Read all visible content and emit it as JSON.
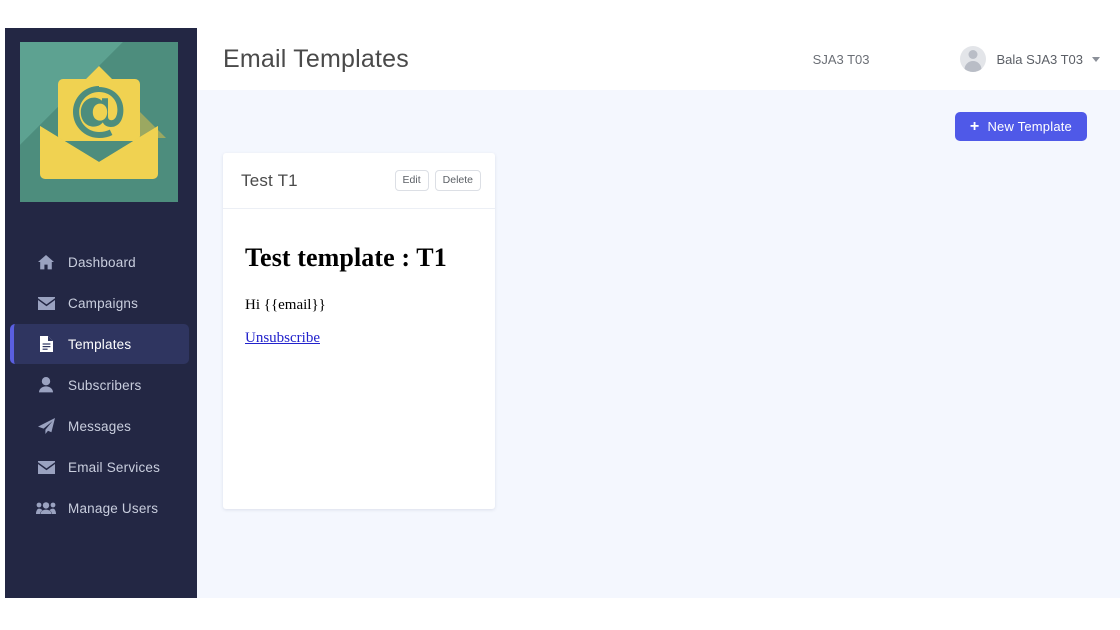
{
  "sidebar": {
    "logo": {
      "name": "email-app-logo",
      "symbol": "@",
      "tile_color": "#5da291",
      "shadow_color": "#4d8d7d",
      "envelope_color": "#f0d251"
    },
    "items": [
      {
        "label": "Dashboard",
        "icon": "home-icon",
        "active": false
      },
      {
        "label": "Campaigns",
        "icon": "envelope-icon",
        "active": false
      },
      {
        "label": "Templates",
        "icon": "document-icon",
        "active": true
      },
      {
        "label": "Subscribers",
        "icon": "user-icon",
        "active": false
      },
      {
        "label": "Messages",
        "icon": "paper-plane-icon",
        "active": false
      },
      {
        "label": "Email Services",
        "icon": "envelope-icon",
        "active": false
      },
      {
        "label": "Manage Users",
        "icon": "users-icon",
        "active": false
      }
    ]
  },
  "header": {
    "title": "Email Templates",
    "tenant": "SJA3 T03",
    "user_name": "Bala SJA3 T03",
    "avatar": "user-avatar-placeholder",
    "caret": "chevron-down-icon"
  },
  "toolbar": {
    "new_template_label": "New Template",
    "new_template_icon": "plus-icon",
    "button_color": "#4f59e8",
    "annotation_color": "#dd3b3b"
  },
  "templates": [
    {
      "name": "Test T1",
      "edit_label": "Edit",
      "delete_label": "Delete",
      "preview": {
        "heading": "Test template : T1",
        "greeting": "Hi {{email}}",
        "unsubscribe": "Unsubscribe",
        "link_color": "#2222cc"
      }
    }
  ],
  "theme": {
    "sidebar_bg": "#232744",
    "active_item_bg": "#2f3560",
    "active_item_accent": "#5a5fe0",
    "content_bg": "#f4f7fe",
    "topbar_bg": "#ffffff"
  }
}
